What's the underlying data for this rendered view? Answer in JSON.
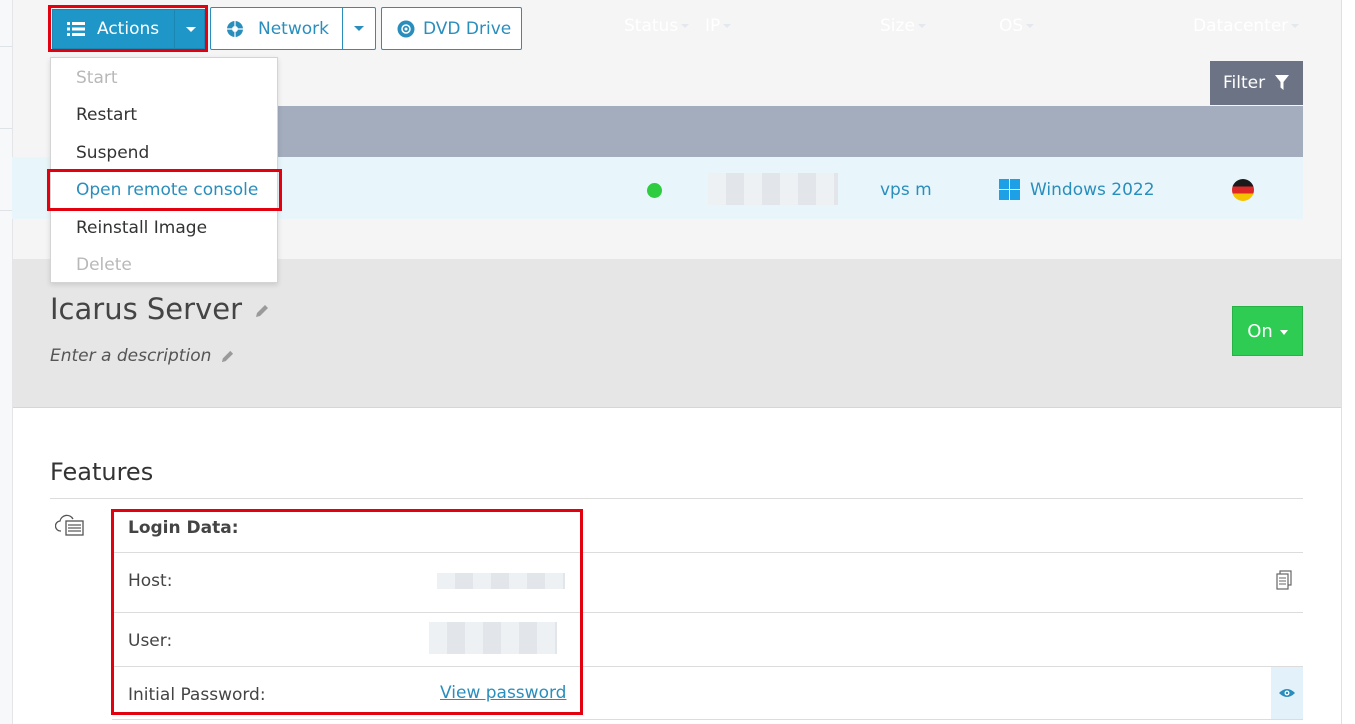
{
  "toolbar": {
    "actions_label": "Actions",
    "network_label": "Network",
    "dvd_label": "DVD Drive",
    "filter_label": "Filter"
  },
  "actions_menu": {
    "items": [
      {
        "label": "Start",
        "state": "disabled"
      },
      {
        "label": "Restart",
        "state": "enabled"
      },
      {
        "label": "Suspend",
        "state": "enabled"
      },
      {
        "label": "Open remote console",
        "state": "highlighted"
      },
      {
        "label": "Reinstall Image",
        "state": "enabled"
      },
      {
        "label": "Delete",
        "state": "disabled"
      }
    ]
  },
  "table": {
    "columns": [
      "Status",
      "IP",
      "Size",
      "OS",
      "Datacenter"
    ],
    "row": {
      "status": "online",
      "ip": "",
      "size": "vps m",
      "os": "Windows 2022",
      "datacenter_flag": "germany-flag"
    }
  },
  "server": {
    "name": "Icarus Server",
    "description_placeholder": "Enter a description",
    "power_label": "On"
  },
  "features": {
    "title": "Features",
    "login_heading": "Login Data:",
    "host_label": "Host:",
    "user_label": "User:",
    "password_label": "Initial Password:",
    "view_password_link": "View password"
  },
  "colors": {
    "primary": "#1f96c8",
    "link": "#2a8ebd",
    "highlight_border": "#e3000f",
    "status_online": "#2ecc40",
    "power_on": "#2ecc52",
    "table_header": "#a3adbe",
    "filter_button": "#6b7385"
  },
  "icons": [
    "list-icon",
    "network-icon",
    "disc-icon",
    "filter-icon",
    "windows-icon",
    "pencil-icon",
    "server-icon",
    "copy-icon",
    "eye-icon"
  ]
}
